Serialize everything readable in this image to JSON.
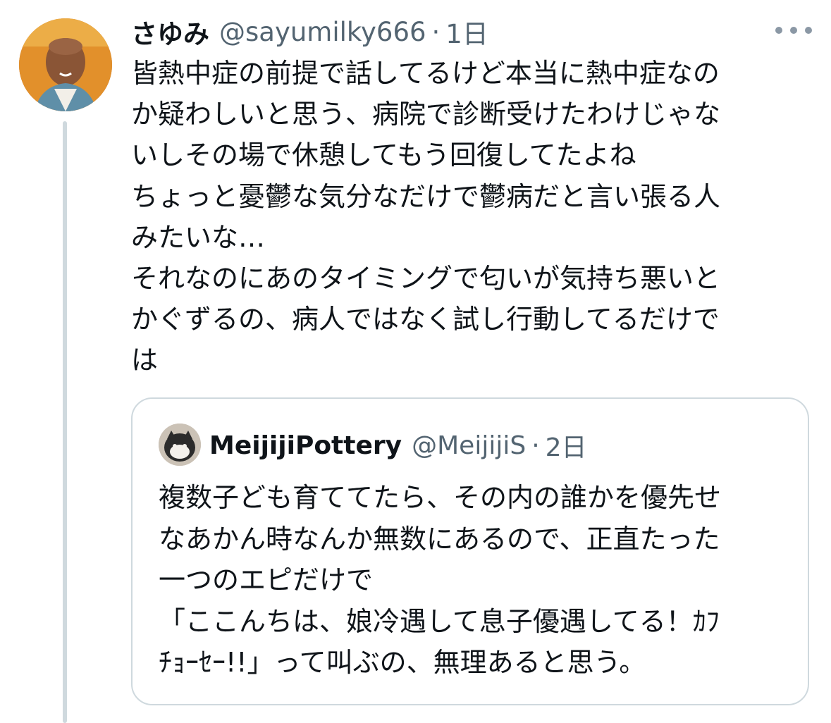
{
  "tweet": {
    "display_name": "さゆみ",
    "handle": "@sayumilky666",
    "separator": "·",
    "time": "1日",
    "text_lines": [
      "皆熱中症の前提で話してるけど本当に熱中症なの",
      "か疑わしいと思う、病院で診断受けたわけじゃな",
      "いしその場で休憩してもう回復してたよね",
      "ちょっと憂鬱な気分なだけで鬱病だと言い張る人",
      "みたいな…",
      "それなのにあのタイミングで匂いが気持ち悪いと",
      "かぐずるの、病人ではなく試し行動してるだけで",
      "は"
    ]
  },
  "quote": {
    "display_name": "MeijijiPottery",
    "handle": "@MeijijiS",
    "separator": "·",
    "time": "2日",
    "text_lines": [
      "複数子ども育ててたら、その内の誰かを優先せ",
      "なあかん時なんか無数にあるので、正直たった",
      "一つのエピだけで",
      "「ここんちは、娘冷遇して息子優遇してる！ｶﾌ",
      "ﾁｮｰｾｰ!!」って叫ぶの、無理あると思う。"
    ]
  },
  "icons": {
    "more": "more-horizontal-icon"
  },
  "colors": {
    "text_primary": "#0f1419",
    "text_secondary": "#536471",
    "border": "#cfd9de"
  }
}
